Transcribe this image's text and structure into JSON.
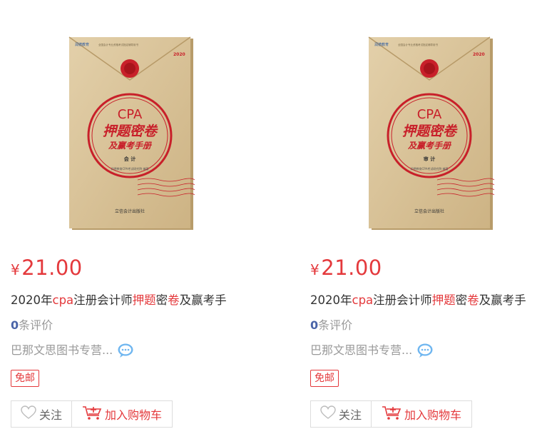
{
  "products": [
    {
      "cover": {
        "publisher_logo": "润德教育",
        "series_note": "全国会计专业资格考试指定辅导用书",
        "year": "2020",
        "brand": "CPA",
        "line1": "押题密卷",
        "line2": "及赢考手册",
        "subject": "会 计",
        "authors": "润德教育CPA考试研究院 编著",
        "press": "立信会计出版社"
      },
      "price_symbol": "¥",
      "price": "21.00",
      "title_parts": [
        "2020年",
        "cpa",
        "注册会计师",
        "押题",
        "密",
        "卷",
        "及赢考手"
      ],
      "title_kw": [
        false,
        true,
        false,
        true,
        false,
        true,
        false
      ],
      "review_count": "0",
      "review_label": "条评价",
      "shop_name": "巴那文思图书专营...",
      "tag": "免邮",
      "follow_label": "关注",
      "cart_label": "加入购物车"
    },
    {
      "cover": {
        "publisher_logo": "润德教育",
        "series_note": "全国会计专业资格考试指定辅导用书",
        "year": "2020",
        "brand": "CPA",
        "line1": "押题密卷",
        "line2": "及赢考手册",
        "subject": "审 计",
        "authors": "润德教育CPA考试研究院 编著",
        "press": "立信会计出版社"
      },
      "price_symbol": "¥",
      "price": "21.00",
      "title_parts": [
        "2020年",
        "cpa",
        "注册会计师",
        "押题",
        "密",
        "卷",
        "及赢考手"
      ],
      "title_kw": [
        false,
        true,
        false,
        true,
        false,
        true,
        false
      ],
      "review_count": "0",
      "review_label": "条评价",
      "shop_name": "巴那文思图书专营...",
      "tag": "免邮",
      "follow_label": "关注",
      "cart_label": "加入购物车"
    }
  ],
  "colors": {
    "accent": "#e4393c",
    "count": "#4a64a8",
    "envelope": "#d8c29a"
  },
  "icons": [
    "heart-icon",
    "cart-icon",
    "chat-icon"
  ]
}
